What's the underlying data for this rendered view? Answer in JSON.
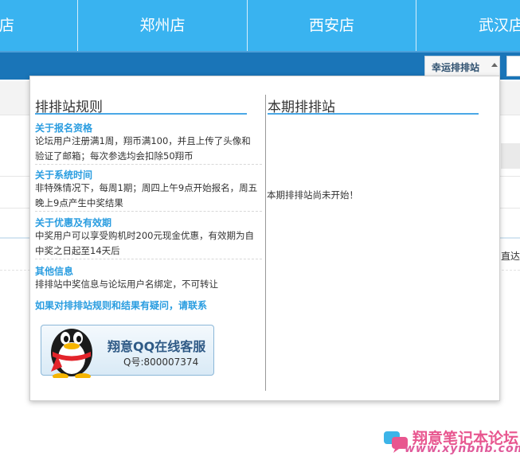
{
  "nav": {
    "cities": [
      "店",
      "郑州店",
      "西安店",
      "武汉店"
    ]
  },
  "tabs": {
    "luck_label": "幸运排排站"
  },
  "background": {
    "partial_text": "直达"
  },
  "panel": {
    "rules_title": "排排站规则",
    "current_title": "本期排排站",
    "sections": [
      {
        "title": "关于报名资格",
        "body": "论坛用户注册满1周，翔币满100，并且上传了头像和验证了邮箱；每次参选均会扣除50翔币"
      },
      {
        "title": "关于系统时间",
        "body": "非特殊情况下，每周1期；周四上午9点开始报名，周五晚上9点产生中奖结果"
      },
      {
        "title": "关于优惠及有效期",
        "body": "中奖用户可以享受购机时200元现金优惠，有效期为自中奖之日起至14天后"
      },
      {
        "title": "其他信息",
        "body": "排排站中奖信息与论坛用户名绑定，不可转让"
      }
    ],
    "contact": "如果对排排站规则和结果有疑问，请联系",
    "qq": {
      "title": "翔意QQ在线客服",
      "number": "Q号:800007374"
    },
    "current_message": "本期排排站尚未开始！"
  },
  "watermark": {
    "title": "翔意笔记本论坛",
    "url": "www.xynbnb.com"
  },
  "colors": {
    "nav_bg": "#39b3f0",
    "strip_bg": "#1a75b8",
    "accent": "#2a9de0",
    "heading_line": "#4aa8e6"
  }
}
